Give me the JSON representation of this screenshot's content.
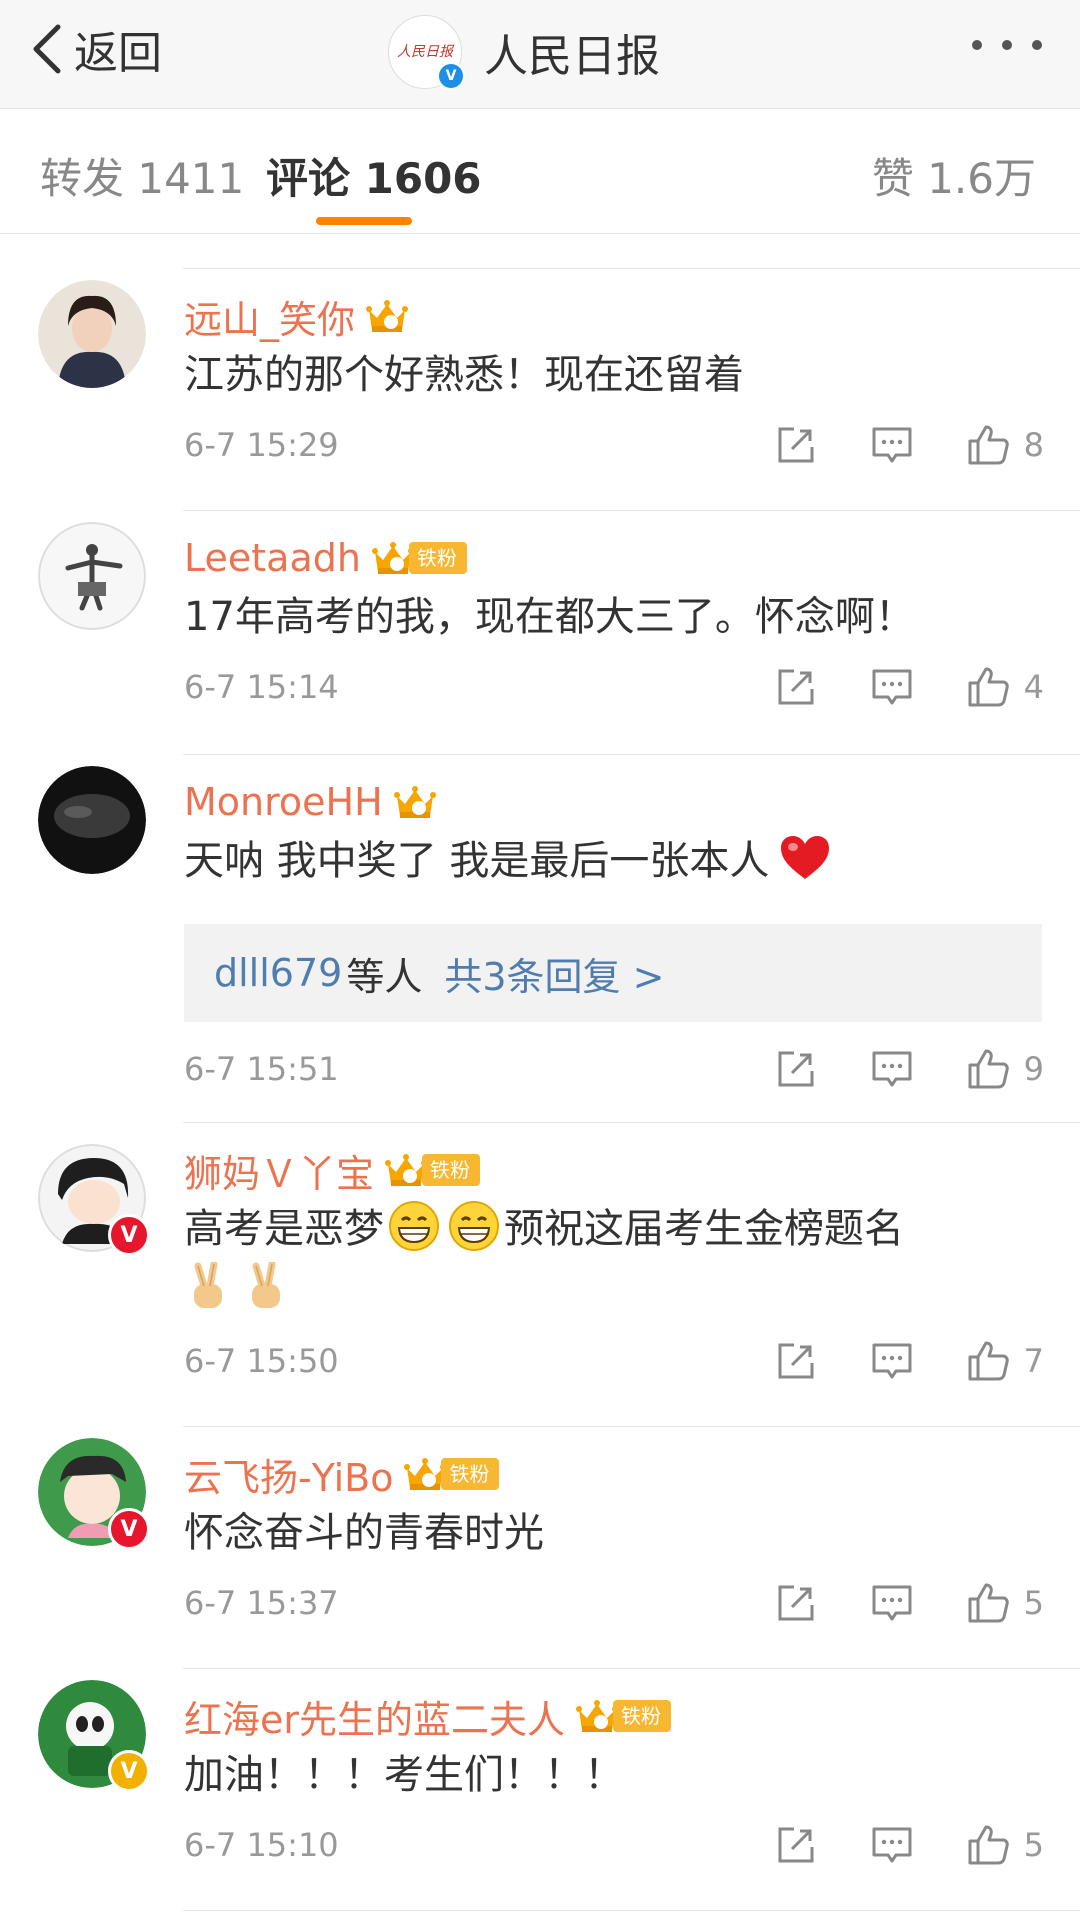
{
  "header": {
    "back_label": "返回",
    "title": "人民日报",
    "logo_text": "人民日报",
    "verified_badge": "V"
  },
  "tabs": {
    "repost": "转发 1411",
    "comments": "评论 1606",
    "likes": "赞 1.6万"
  },
  "colors": {
    "accent": "#ff8200",
    "username": "#eb7350",
    "link_blue": "#507daf"
  },
  "comments": [
    {
      "username": "远山_笑你",
      "level": "3",
      "fan_badge": "",
      "text": "江苏的那个好熟悉！现在还留着",
      "time": "6-7 15:29",
      "likes": "8",
      "verified": ""
    },
    {
      "username": "Leetaadh",
      "level": "2",
      "fan_badge": "铁粉",
      "text": "17年高考的我，现在都大三了。怀念啊！",
      "time": "6-7 15:14",
      "likes": "4",
      "verified": ""
    },
    {
      "username": "MonroeHH",
      "level": "2",
      "fan_badge": "",
      "text": "天呐 我中奖了 我是最后一张本人",
      "emoji": "heart-emoji",
      "replies": {
        "who": "dlll679",
        "etc": "等人",
        "total": "共3条回复 >"
      },
      "time": "6-7 15:51",
      "likes": "9",
      "verified": ""
    },
    {
      "username": "狮妈Ｖ丫宝",
      "level": "5",
      "fan_badge": "铁粉",
      "text_a": "高考是恶梦",
      "text_b": "预祝这届考生金榜题名",
      "emoji": "grin-emoji victory-hand-emoji",
      "time": "6-7 15:50",
      "likes": "7",
      "verified": "V"
    },
    {
      "username": "云飞扬-YiBo",
      "level": "6",
      "fan_badge": "铁粉",
      "text": "怀念奋斗的青春时光",
      "time": "6-7 15:37",
      "likes": "5",
      "verified": "V"
    },
    {
      "username": "红海er先生的蓝二夫人",
      "level": "4",
      "fan_badge": "铁粉",
      "text": "加油！！！考生们！！！",
      "time": "6-7 15:10",
      "likes": "5",
      "verified": "V"
    }
  ]
}
